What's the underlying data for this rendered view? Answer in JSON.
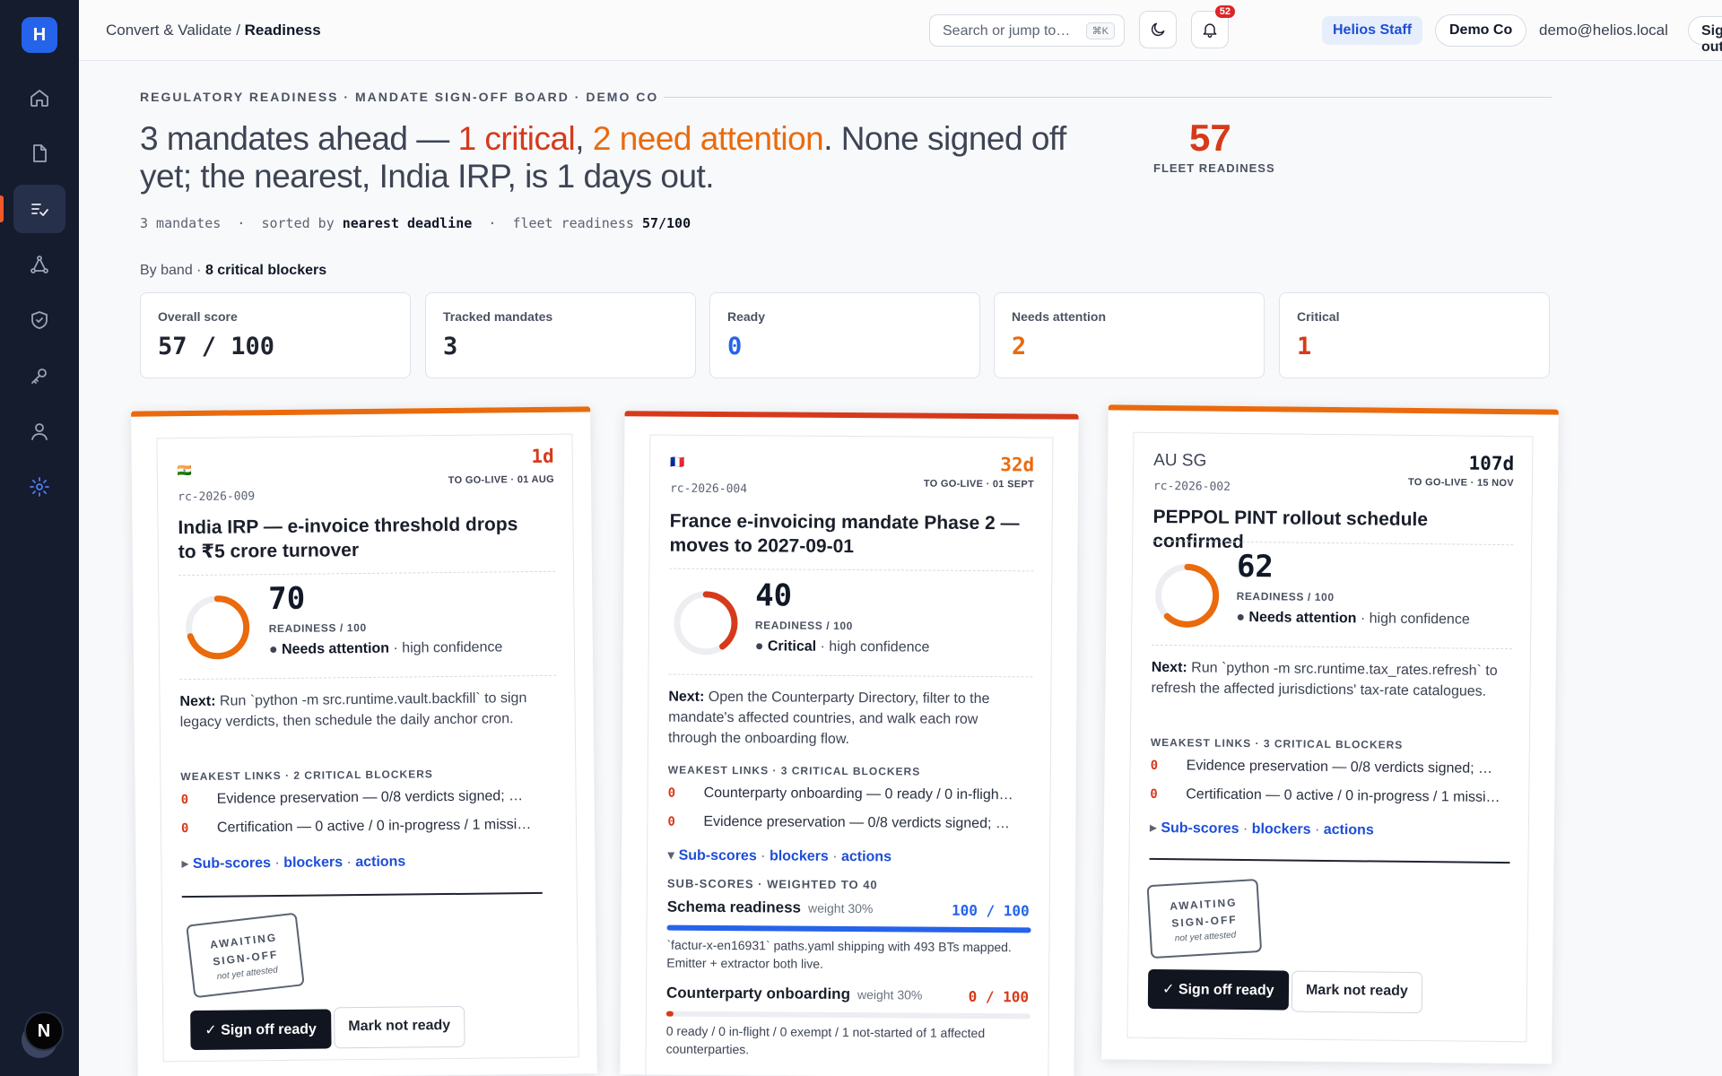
{
  "app": {
    "logo_letter": "H",
    "user_initial": "N"
  },
  "sidebar": {
    "items": [
      {
        "name": "home-icon"
      },
      {
        "name": "document-icon"
      },
      {
        "name": "readiness-icon"
      },
      {
        "name": "network-icon"
      },
      {
        "name": "shield-icon"
      },
      {
        "name": "key-icon"
      },
      {
        "name": "user-icon"
      },
      {
        "name": "gear-icon"
      }
    ]
  },
  "topbar": {
    "breadcrumb_parent": "Convert & Validate",
    "breadcrumb_sep": " / ",
    "breadcrumb_current": "Readiness",
    "search_placeholder": "Search or jump to…",
    "search_shortcut": "⌘K",
    "notif_count": "52",
    "staff_label": "Helios Staff",
    "company": "Demo Co",
    "email": "demo@helios.local",
    "signout": "Sign out"
  },
  "header": {
    "eyebrow": "REGULATORY READINESS · MANDATE SIGN-OFF BOARD · DEMO CO",
    "headline_pre": "3 mandates ahead — ",
    "headline_crit": "1 critical",
    "headline_comma": ", ",
    "headline_attn": "2 need attention",
    "headline_post": ". None signed off yet; the nearest, India IRP, is 1 days out.",
    "fleet_score": "57",
    "fleet_label": "FLEET READINESS",
    "meta_count": "3 mandates",
    "meta_sep": "  ·  ",
    "meta_sort_pre": "sorted by ",
    "meta_sort": "nearest deadline",
    "meta_fleet_pre": "fleet readiness ",
    "meta_fleet": "57/100",
    "byband_pre": "By band · ",
    "byband_blockers": "8 critical blockers"
  },
  "stats": [
    {
      "label": "Overall score",
      "value": "57 / 100",
      "color": "#111827"
    },
    {
      "label": "Tracked mandates",
      "value": "3",
      "color": "#111827"
    },
    {
      "label": "Ready",
      "value": "0",
      "color": "#2563eb"
    },
    {
      "label": "Needs attention",
      "value": "2",
      "color": "#ea6a0c"
    },
    {
      "label": "Critical",
      "value": "1",
      "color": "#d63a1b"
    }
  ],
  "colors": {
    "critical": "#d63a1b",
    "attention": "#ea6a0c",
    "ready": "#2563eb",
    "track": "#eceef2"
  },
  "mandates": [
    {
      "flag": "🇮🇳",
      "ref": "rc-2026-009",
      "days": "1d",
      "golive": "TO GO-LIVE · 01 AUG",
      "title": "India IRP — e-invoice threshold drops to ₹5 crore turnover",
      "score": "70",
      "score_label": "READINESS / 100",
      "score_fraction": 0.7,
      "status": "Needs attention",
      "confidence": " · high confidence",
      "next_label": "Next:",
      "next_text": " Run `python -m src.runtime.vault.backfill` to sign legacy verdicts, then schedule the daily anchor cron.",
      "weak_label": "WEAKEST LINKS · 2 CRITICAL BLOCKERS",
      "blockers": [
        {
          "score": "0",
          "text": "Evidence preservation — 0/8 verdicts signed; …"
        },
        {
          "score": "0",
          "text": "Certification — 0 active / 0 in-progress / 1 missi…"
        }
      ],
      "links": {
        "arrow": "▸",
        "a": "Sub-scores",
        "b": "blockers",
        "c": "actions",
        "sep": " · "
      },
      "stamp": {
        "line1": "AWAITING",
        "line2": "SIGN-OFF",
        "line3": "not yet attested"
      },
      "sign_btn": "✓ Sign off ready",
      "mark_btn": "Mark not ready"
    },
    {
      "flag": "🇫🇷",
      "ref": "rc-2026-004",
      "days": "32d",
      "golive": "TO GO-LIVE · 01 SEPT",
      "title": "France e-invoicing mandate Phase 2 — moves to 2027-09-01",
      "score": "40",
      "score_label": "READINESS / 100",
      "score_fraction": 0.4,
      "status": "Critical",
      "confidence": " · high confidence",
      "next_label": "Next:",
      "next_text": " Open the Counterparty Directory, filter to the mandate's affected countries, and walk each row through the onboarding flow.",
      "weak_label": "WEAKEST LINKS · 3 CRITICAL BLOCKERS",
      "blockers": [
        {
          "score": "0",
          "text": "Counterparty onboarding — 0 ready / 0 in-fligh…"
        },
        {
          "score": "0",
          "text": "Evidence preservation — 0/8 verdicts signed; …"
        }
      ],
      "links": {
        "arrow": "▾",
        "a": "Sub-scores",
        "b": "blockers",
        "c": "actions",
        "sep": " · "
      },
      "subscores_label": "SUB-SCORES · WEIGHTED TO 40",
      "subscores": [
        {
          "name": "Schema readiness",
          "weight": "weight 30%",
          "score": "100 / 100",
          "fraction": 1.0,
          "color": "#2563eb",
          "desc": "`factur-x-en16931` paths.yaml shipping with 493 BTs mapped. Emitter + extractor both live."
        },
        {
          "name": "Counterparty onboarding",
          "weight": "weight 30%",
          "score": "0 / 100",
          "fraction": 0.0,
          "color": "#d63a1b",
          "desc": "0 ready / 0 in-flight / 0 exempt / 1 not-started of 1 affected counterparties."
        }
      ]
    },
    {
      "flag_text": "AU SG",
      "ref": "rc-2026-002",
      "days": "107d",
      "golive": "TO GO-LIVE · 15 NOV",
      "title": "PEPPOL PINT rollout schedule confirmed",
      "score": "62",
      "score_label": "READINESS / 100",
      "score_fraction": 0.62,
      "status": "Needs attention",
      "confidence": " · high confidence",
      "next_label": "Next:",
      "next_text": " Run `python -m src.runtime.tax_rates.refresh` to refresh the affected jurisdictions' tax-rate catalogues.",
      "weak_label": "WEAKEST LINKS · 3 CRITICAL BLOCKERS",
      "blockers": [
        {
          "score": "0",
          "text": "Evidence preservation — 0/8 verdicts signed; …"
        },
        {
          "score": "0",
          "text": "Certification — 0 active / 0 in-progress / 1 missi…"
        }
      ],
      "links": {
        "arrow": "▸",
        "a": "Sub-scores",
        "b": "blockers",
        "c": "actions",
        "sep": " · "
      },
      "stamp": {
        "line1": "AWAITING",
        "line2": "SIGN-OFF",
        "line3": "not yet attested"
      },
      "sign_btn": "✓ Sign off ready",
      "mark_btn": "Mark not ready"
    }
  ]
}
